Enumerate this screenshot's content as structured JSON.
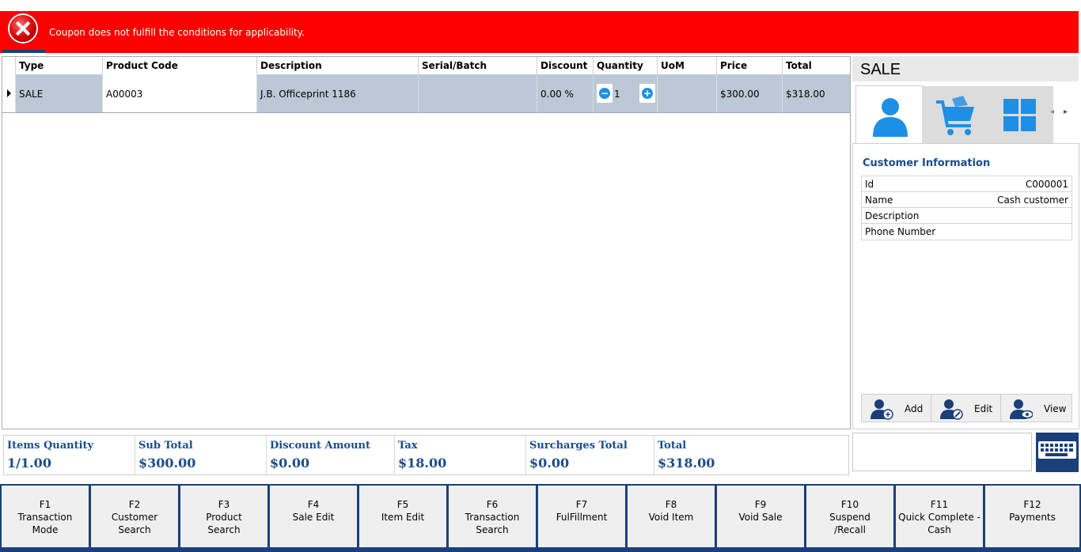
{
  "banner": {
    "message": "Coupon does not fulfill the conditions for applicability.",
    "icon": "error-icon",
    "color": "#ff0000"
  },
  "grid": {
    "columns": [
      "Type",
      "Product Code",
      "Description",
      "Serial/Batch",
      "Discount",
      "Quantity",
      "UoM",
      "Price",
      "Total"
    ],
    "rows": [
      {
        "type": "SALE",
        "product_code": "A00003",
        "description": "J.B. Officeprint 1186",
        "serial_batch": "",
        "discount": "0.00 %",
        "quantity": "1",
        "uom": "",
        "price": "$300.00",
        "total": "$318.00"
      }
    ]
  },
  "side": {
    "title": "SALE",
    "tabs": [
      "customer-icon",
      "cart-icon",
      "tiles-icon"
    ],
    "customer_info": {
      "title": "Customer Information",
      "rows": [
        {
          "key": "Id",
          "value": "C000001"
        },
        {
          "key": "Name",
          "value": "Cash customer"
        },
        {
          "key": "Description",
          "value": ""
        },
        {
          "key": "Phone Number",
          "value": ""
        }
      ]
    },
    "buttons": {
      "add": "Add",
      "edit": "Edit",
      "view": "View"
    }
  },
  "totals": {
    "items_quantity": {
      "label": "Items Quantity",
      "value": "1/1.00"
    },
    "sub_total": {
      "label": "Sub Total",
      "value": "$300.00"
    },
    "discount_amount": {
      "label": "Discount Amount",
      "value": "$0.00"
    },
    "tax": {
      "label": "Tax",
      "value": "$18.00"
    },
    "surcharges_total": {
      "label": "Surcharges Total",
      "value": "$0.00"
    },
    "total": {
      "label": "Total",
      "value": "$318.00"
    }
  },
  "fkeys": [
    {
      "key": "F1",
      "label": "Transaction\nMode"
    },
    {
      "key": "F2",
      "label": "Customer\nSearch"
    },
    {
      "key": "F3",
      "label": "Product\nSearch"
    },
    {
      "key": "F4",
      "label": "Sale Edit"
    },
    {
      "key": "F5",
      "label": "Item Edit"
    },
    {
      "key": "F6",
      "label": "Transaction\nSearch"
    },
    {
      "key": "F7",
      "label": "FulFillment"
    },
    {
      "key": "F8",
      "label": "Void Item"
    },
    {
      "key": "F9",
      "label": "Void Sale"
    },
    {
      "key": "F10",
      "label": "Suspend\n/Recall"
    },
    {
      "key": "F11",
      "label": "Quick Complete -\nCash"
    },
    {
      "key": "F12",
      "label": "Payments"
    }
  ],
  "colors": {
    "accent": "#1a3f7a",
    "selected_row": "#bcc8d5",
    "label_blue": "#1a4c8b",
    "icon_blue": "#1e8fe6"
  }
}
